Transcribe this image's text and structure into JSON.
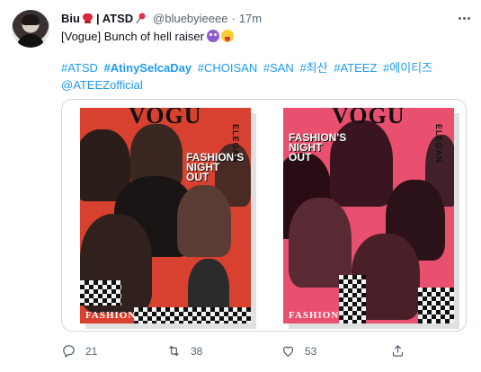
{
  "author": {
    "display_name": "Biu",
    "display_name_suffix": "| ATSD",
    "handle": "@bluebyieeee",
    "separator": "·",
    "time": "17m"
  },
  "tweet": {
    "text": "[Vogue]  Bunch of hell raiser",
    "emoji_1": "smiling-devil-emoji",
    "emoji_2": "tongue-face-emoji",
    "hashtags": [
      {
        "text": "#ATSD",
        "bold": false
      },
      {
        "text": "#AtinySelcaDay",
        "bold": true
      },
      {
        "text": "#CHOISAN",
        "bold": false
      },
      {
        "text": "#SAN",
        "bold": false
      },
      {
        "text": "#최산",
        "bold": false
      },
      {
        "text": "#ATEEZ",
        "bold": false
      },
      {
        "text": "#에이티즈",
        "bold": false
      },
      {
        "text": "@ATEEZofficial",
        "bold": false
      }
    ]
  },
  "media": {
    "left_photo": {
      "title": "VOGU",
      "sub_line_1": "FASHION'S",
      "sub_line_2": "NIGHT",
      "sub_line_3": "OUT",
      "side_text": "ELEGAN",
      "bottom_text": "FASHION"
    },
    "right_photo": {
      "title": "VOGU",
      "sub_line_1": "FASHION'S",
      "sub_line_2": "NIGHT",
      "sub_line_3": "OUT",
      "side_text": "ELEGAN",
      "bottom_text": "FASHION"
    }
  },
  "actions": {
    "reply_count": "21",
    "retweet_count": "38",
    "like_count": "53"
  },
  "colors": {
    "link": "#1d9bf0",
    "secondary_text": "#536471",
    "primary_text": "#0f1419",
    "border": "#cfd9de"
  }
}
